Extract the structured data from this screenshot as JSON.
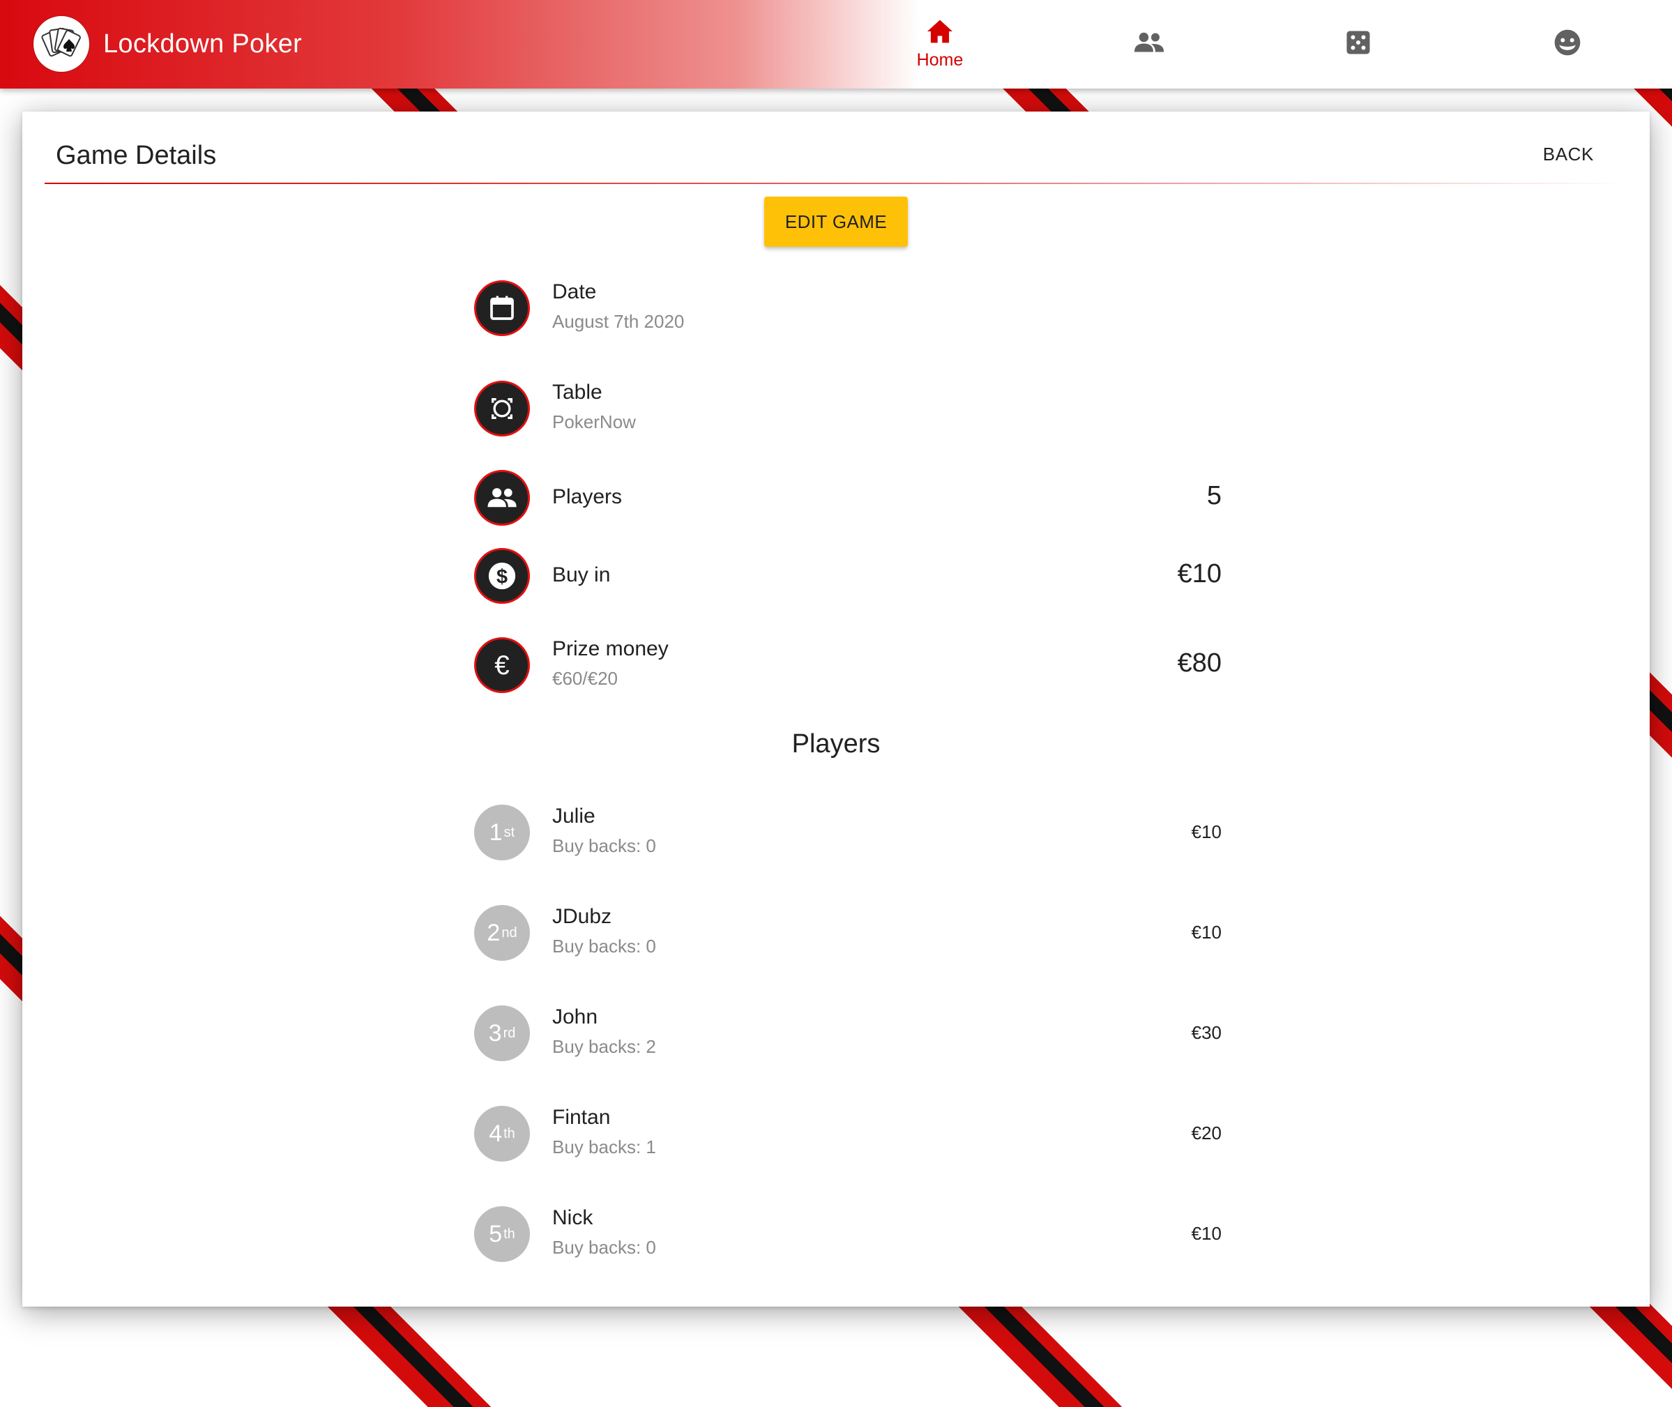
{
  "app": {
    "title": "Lockdown Poker",
    "accent": "#d50000",
    "button_color": "#ffc107"
  },
  "nav": {
    "home_label": "Home",
    "items": [
      {
        "icon": "home-icon",
        "active": true
      },
      {
        "icon": "people-icon",
        "active": false
      },
      {
        "icon": "dice-icon",
        "active": false
      },
      {
        "icon": "face-icon",
        "active": false
      }
    ]
  },
  "card": {
    "title": "Game Details",
    "back_label": "BACK",
    "edit_label": "EDIT GAME"
  },
  "details": {
    "date": {
      "title": "Date",
      "value": "August 7th 2020",
      "icon": "calendar-icon"
    },
    "table": {
      "title": "Table",
      "value": "PokerNow",
      "icon": "table-icon"
    },
    "players": {
      "title": "Players",
      "value": "5",
      "icon": "people-icon"
    },
    "buyin": {
      "title": "Buy in",
      "value": "€10",
      "icon": "dollar-icon"
    },
    "prize": {
      "title": "Prize money",
      "split": "€60/€20",
      "value": "€80",
      "icon": "euro-icon"
    }
  },
  "players_section": {
    "title": "Players",
    "players": [
      {
        "rank": "1",
        "suffix": "st",
        "name": "Julie",
        "buybacks": "Buy backs: 0",
        "amount": "€10"
      },
      {
        "rank": "2",
        "suffix": "nd",
        "name": "JDubz",
        "buybacks": "Buy backs: 0",
        "amount": "€10"
      },
      {
        "rank": "3",
        "suffix": "rd",
        "name": "John",
        "buybacks": "Buy backs: 2",
        "amount": "€30"
      },
      {
        "rank": "4",
        "suffix": "th",
        "name": "Fintan",
        "buybacks": "Buy backs: 1",
        "amount": "€20"
      },
      {
        "rank": "5",
        "suffix": "th",
        "name": "Nick",
        "buybacks": "Buy backs: 0",
        "amount": "€10"
      }
    ]
  }
}
